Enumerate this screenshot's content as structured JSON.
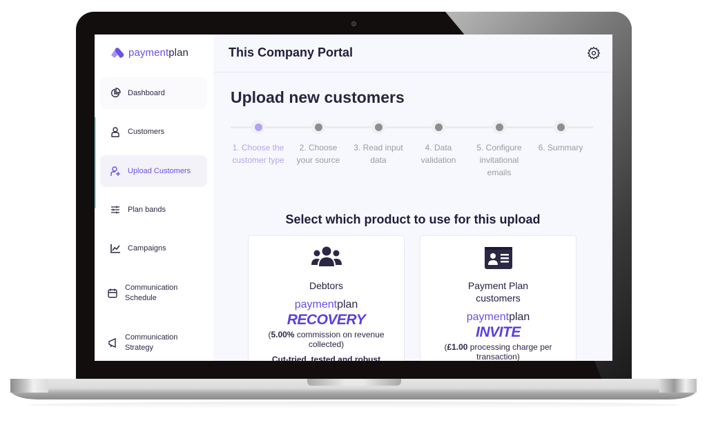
{
  "app": {
    "brand_prefix": "payment",
    "brand_suffix": "plan",
    "portal_title": "This Company Portal"
  },
  "sidebar": {
    "items": [
      {
        "label": "Dashboard",
        "icon": "pie-chart-icon"
      },
      {
        "label": "Customers",
        "icon": "user-icon"
      },
      {
        "label": "Upload Customers",
        "icon": "user-plus-icon",
        "active": true
      },
      {
        "label": "Plan bands",
        "icon": "sliders-icon"
      },
      {
        "label": "Campaigns",
        "icon": "trending-chart-icon"
      },
      {
        "label": "Communication Schedule",
        "icon": "calendar-icon"
      },
      {
        "label": "Communication Strategy",
        "icon": "megaphone-icon"
      }
    ]
  },
  "page": {
    "title": "Upload new customers",
    "steps": [
      {
        "label": "1. Choose the customer type",
        "active": true
      },
      {
        "label": "2. Choose your source",
        "active": false
      },
      {
        "label": "3. Read input data",
        "active": false
      },
      {
        "label": "4. Data validation",
        "active": false
      },
      {
        "label": "5. Configure invitational emails",
        "active": false
      },
      {
        "label": "6. Summary",
        "active": false
      }
    ],
    "select_title": "Select which product to use for this upload",
    "products": [
      {
        "name": "Debtors",
        "icon": "users-group-icon",
        "brand_prefix": "payment",
        "brand_suffix": "plan",
        "product": "RECOVERY",
        "fee_value": "5.00%",
        "fee_text": " commission on revenue collected)",
        "extra": "Cut-tried, tested and robust"
      },
      {
        "name": "Payment Plan customers",
        "icon": "id-card-icon",
        "brand_prefix": "payment",
        "brand_suffix": "plan",
        "product": "INVITE",
        "fee_value": "£1.00",
        "fee_text": " processing charge per transaction)"
      }
    ]
  },
  "colors": {
    "accent": "#6d4fe6",
    "dark_text": "#211d3b",
    "step_inactive": "#8e8e8e",
    "step_active": "#b3a3ef"
  }
}
